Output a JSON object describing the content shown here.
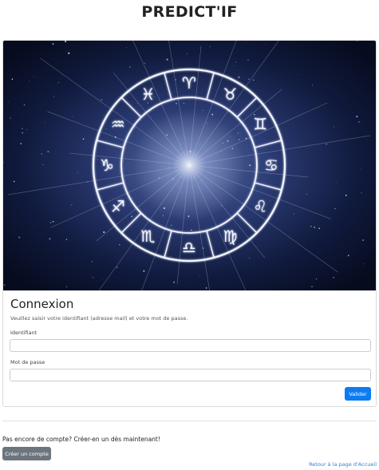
{
  "app": {
    "title": "PREDICT'IF"
  },
  "login": {
    "title": "Connexion",
    "subtitle": "Veuillez saisir votre identifiant (adresse mail) et votre mot de passe.",
    "username_label": "Identifiant",
    "username_value": "",
    "password_label": "Mot de passe",
    "password_value": "",
    "submit_label": "Valider"
  },
  "signup": {
    "prompt": "Pas encore de compte? Créer-en un dès maintenant!",
    "button_label": "Créer un compte"
  },
  "footer": {
    "back_link": "Retour à la page d'Accueil"
  },
  "hero": {
    "image": "zodiac-wheel",
    "zodiac_glyphs": [
      "♈",
      "♉",
      "♊",
      "♋",
      "♌",
      "♍",
      "♎",
      "♏",
      "♐",
      "♑",
      "♒",
      "♓"
    ]
  },
  "colors": {
    "primary": "#0d7cf2",
    "secondary": "#6c757d",
    "link": "#3a7fd0",
    "hero_background": "#0a0f25"
  }
}
